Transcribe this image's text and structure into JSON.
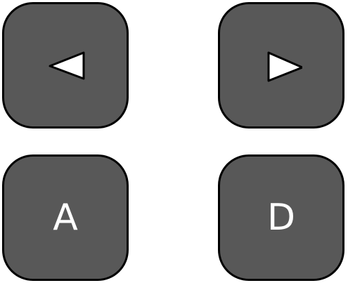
{
  "keys": [
    {
      "id": "left",
      "icon": "left-arrow-icon"
    },
    {
      "id": "right",
      "icon": "right-arrow-icon"
    },
    {
      "id": "a",
      "label": "A"
    },
    {
      "id": "d",
      "label": "D"
    }
  ],
  "colors": {
    "key_fill": "#585858",
    "key_border": "#000000",
    "glyph": "#ffffff"
  }
}
